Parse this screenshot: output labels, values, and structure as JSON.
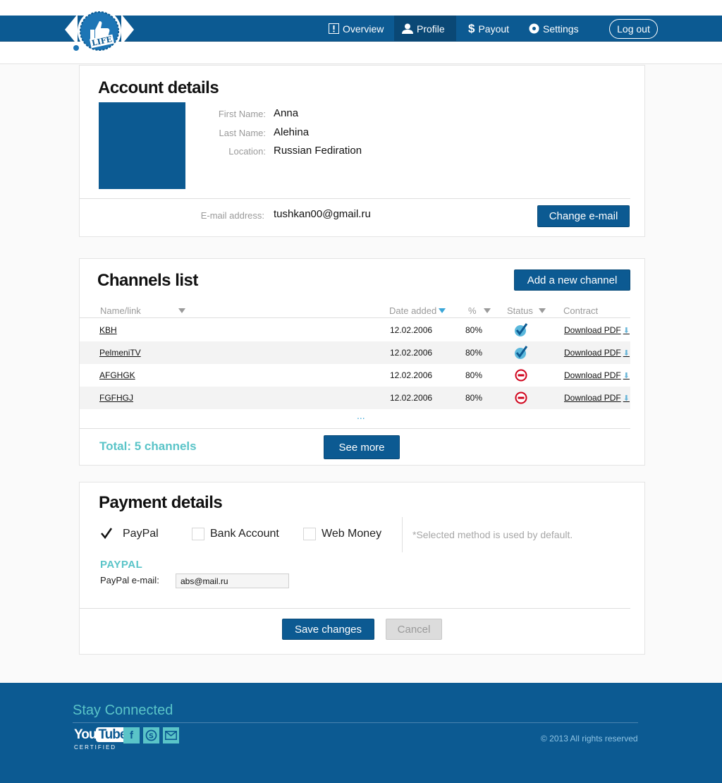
{
  "nav": {
    "overview": "Overview",
    "profile": "Profile",
    "payout": "Payout",
    "settings": "Settings",
    "logout": "Log out",
    "logo_text": "LIFE"
  },
  "account": {
    "title": "Account details",
    "first_name_label": "First Name:",
    "first_name": "Anna",
    "last_name_label": "Last Name:",
    "last_name": "Alehina",
    "location_label": "Location:",
    "location": "Russian Fediration",
    "email_label": "E-mail address:",
    "email": "tushkan00@gmail.ru",
    "change_email": "Change e-mail"
  },
  "channels": {
    "title": "Channels list",
    "add_button": "Add a new channel",
    "headers": {
      "name": "Name/link",
      "date": "Date added",
      "pct": "%",
      "status": "Status",
      "contract": "Contract"
    },
    "rows": [
      {
        "name": "KBH",
        "date": "12.02.2006",
        "pct": "80%",
        "status": "ok",
        "contract": "Download PDF"
      },
      {
        "name": "PelmeniTV",
        "date": "12.02.2006",
        "pct": "80%",
        "status": "ok",
        "contract": "Download PDF"
      },
      {
        "name": "AFGHGK",
        "date": "12.02.2006",
        "pct": "80%",
        "status": "blocked",
        "contract": "Download PDF"
      },
      {
        "name": "FGFHGJ",
        "date": "12.02.2006",
        "pct": "80%",
        "status": "blocked",
        "contract": "Download PDF"
      }
    ],
    "ellipsis": "...",
    "total": "Total: 5 channels",
    "see_more": "See more"
  },
  "payment": {
    "title": "Payment details",
    "options": [
      {
        "label": "PayPal",
        "checked": true
      },
      {
        "label": "Bank Account",
        "checked": false
      },
      {
        "label": "Web Money",
        "checked": false
      }
    ],
    "note": "*Selected method is used by default.",
    "paypal_title": "PAYPAL",
    "paypal_email_label": "PayPal e-mail:",
    "paypal_email": "abs@mail.ru",
    "save": "Save changes",
    "cancel": "Cancel"
  },
  "footer": {
    "stay_connected": "Stay Connected",
    "youtube_you": "You",
    "youtube_tube": "Tube",
    "youtube_certified": "CERTIFIED",
    "copyright": "© 2013 All rights reserved",
    "social": [
      "facebook-icon",
      "skype-icon",
      "mail-icon"
    ]
  },
  "colors": {
    "brand_blue": "#0c5a92",
    "accent_teal": "#5ac4c8",
    "status_ok": "#3aa6d8",
    "status_blocked": "#d0021b"
  }
}
